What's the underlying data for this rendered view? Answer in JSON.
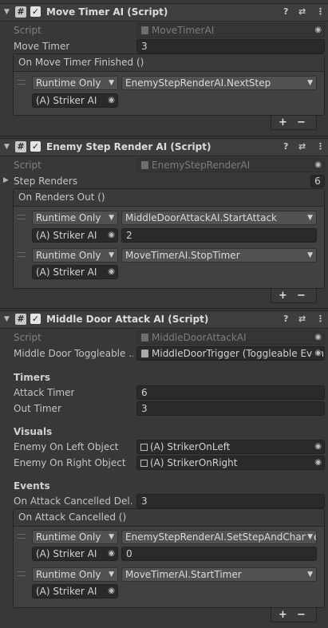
{
  "components": [
    {
      "title": "Move Timer AI (Script)",
      "script_label": "Script",
      "script_value": "MoveTimerAI",
      "move_timer_label": "Move Timer",
      "move_timer_value": "3",
      "event": {
        "header": "On Move Timer Finished ()",
        "listeners": [
          {
            "mode": "Runtime Only",
            "function": "EnemyStepRenderAI.NextStep",
            "target": "(A) Striker AI"
          }
        ]
      }
    },
    {
      "title": "Enemy Step Render AI (Script)",
      "script_label": "Script",
      "script_value": "EnemyStepRenderAI",
      "step_renders_label": "Step Renders",
      "step_renders_count": "6",
      "event": {
        "header": "On Renders Out ()",
        "listeners": [
          {
            "mode": "Runtime Only",
            "function": "MiddleDoorAttackAI.StartAttack",
            "target": "(A) Striker AI",
            "arg": "2"
          },
          {
            "mode": "Runtime Only",
            "function": "MoveTimerAI.StopTimer",
            "target": "(A) Striker AI"
          }
        ]
      }
    },
    {
      "title": "Middle Door Attack AI (Script)",
      "script_label": "Script",
      "script_value": "MiddleDoorAttackAI",
      "toggleable_label": "Middle Door Toggleable ...",
      "toggleable_value": "MiddleDoorTrigger (Toggleable Event)",
      "timers_header": "Timers",
      "attack_timer_label": "Attack Timer",
      "attack_timer_value": "6",
      "out_timer_label": "Out Timer",
      "out_timer_value": "3",
      "visuals_header": "Visuals",
      "left_label": "Enemy On Left Object",
      "left_value": "(A) StrikerOnLeft",
      "right_label": "Enemy On Right Object",
      "right_value": "(A) StrikerOnRight",
      "events_header": "Events",
      "cancel_delay_label": "On Attack Cancelled Del...",
      "cancel_delay_value": "3",
      "event": {
        "header": "On Attack Cancelled ()",
        "listeners": [
          {
            "mode": "Runtime Only",
            "function": "EnemyStepRenderAI.SetStepAndChangeRender",
            "target": "(A) Striker AI",
            "arg": "0"
          },
          {
            "mode": "Runtime Only",
            "function": "MoveTimerAI.StartTimer",
            "target": "(A) Striker AI"
          }
        ]
      }
    }
  ],
  "icons": {
    "foldout": "triangle-down-icon",
    "script": "script-hash-icon",
    "help": "help-icon",
    "presets": "presets-sliders-icon",
    "menu": "kebab-menu-icon"
  },
  "buttons": {
    "add": "+",
    "remove": "−"
  }
}
